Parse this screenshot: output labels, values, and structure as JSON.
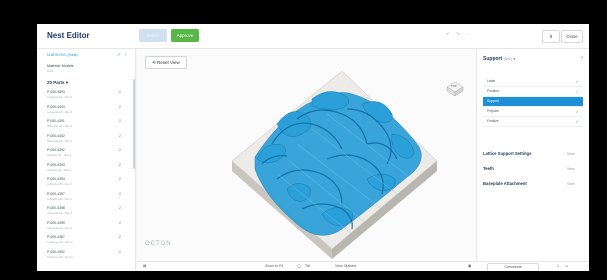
{
  "app": {
    "title": "Nest Editor"
  },
  "header": {
    "button1_label": "Reject",
    "approve_label": "Approve",
    "page_label": "9",
    "close_label": "Close"
  },
  "left": {
    "file_label": "N-ARS-RVC (Nest)",
    "material": "Material: Models",
    "material_sub": "Dark",
    "parts_header": "20 Parts ▾",
    "parts": [
      {
        "id": "P-000-4893",
        "sub": "Lorgugal-w5 - Rev 2",
        "count": "2"
      },
      {
        "id": "P-000-4403",
        "sub": "Lorgugal-w5 - Rev 2",
        "count": "2"
      },
      {
        "id": "P-000-4391",
        "sub": "Mikrovisi-w5 - Rev 2",
        "count": "2"
      },
      {
        "id": "P-000-4402",
        "sub": "Mikrovisi-w5 - Rev 2",
        "count": "2"
      },
      {
        "id": "P-000-4392",
        "sub": "Siebling-w5 - Rev 2",
        "count": "2"
      },
      {
        "id": "P-000-4393",
        "sub": "Siebling-w5 - Rev 2",
        "count": "2"
      },
      {
        "id": "P-000-4394",
        "sub": "Lubbelts-w5 - Rev 2",
        "count": "2"
      },
      {
        "id": "P-000-4397",
        "sub": "Lubbelts-w5 - Rev 2",
        "count": "2"
      },
      {
        "id": "P-000-4398",
        "sub": "Anteerile-w5 - Rev 2",
        "count": "2"
      },
      {
        "id": "P-000-4399",
        "sub": "Anteerile-w5 - Rev 2",
        "count": "2"
      },
      {
        "id": "P-000-4387",
        "sub": "Traberge-w5 - Rev 2",
        "count": "2"
      },
      {
        "id": "P-000-4402",
        "sub": "Traberge-w5 - Rev 2",
        "count": "2"
      }
    ]
  },
  "viewport": {
    "reset_view": "Reset View",
    "brand": "OCTON",
    "viewcube_label": "TOP"
  },
  "right": {
    "support_title": "Support",
    "support_count": "(5/5)",
    "tabs": [
      {
        "label": "Label",
        "checked": "✓"
      },
      {
        "label": "Position",
        "checked": "✓"
      },
      {
        "label": "Support",
        "checked": ""
      },
      {
        "label": "Prepare",
        "checked": "✓"
      },
      {
        "label": "Finalize",
        "checked": "✓"
      }
    ],
    "sections": [
      {
        "label": "Lattice Support Settings",
        "value": "View"
      },
      {
        "label": "Teeth",
        "value": "View"
      },
      {
        "label": "Baseplate Attachment",
        "value": "View"
      }
    ]
  },
  "bottom": {
    "zoom": "Zoom to Fit",
    "tilt": "Tilt",
    "view_options": "View Options",
    "comments": "Comments",
    "page_count": "1"
  },
  "colors": {
    "accent_green": "#5cb85c",
    "selected_blue": "#1d8fd6",
    "model_blue": "#2a9fd8",
    "base_gray": "#e6e4e0"
  }
}
